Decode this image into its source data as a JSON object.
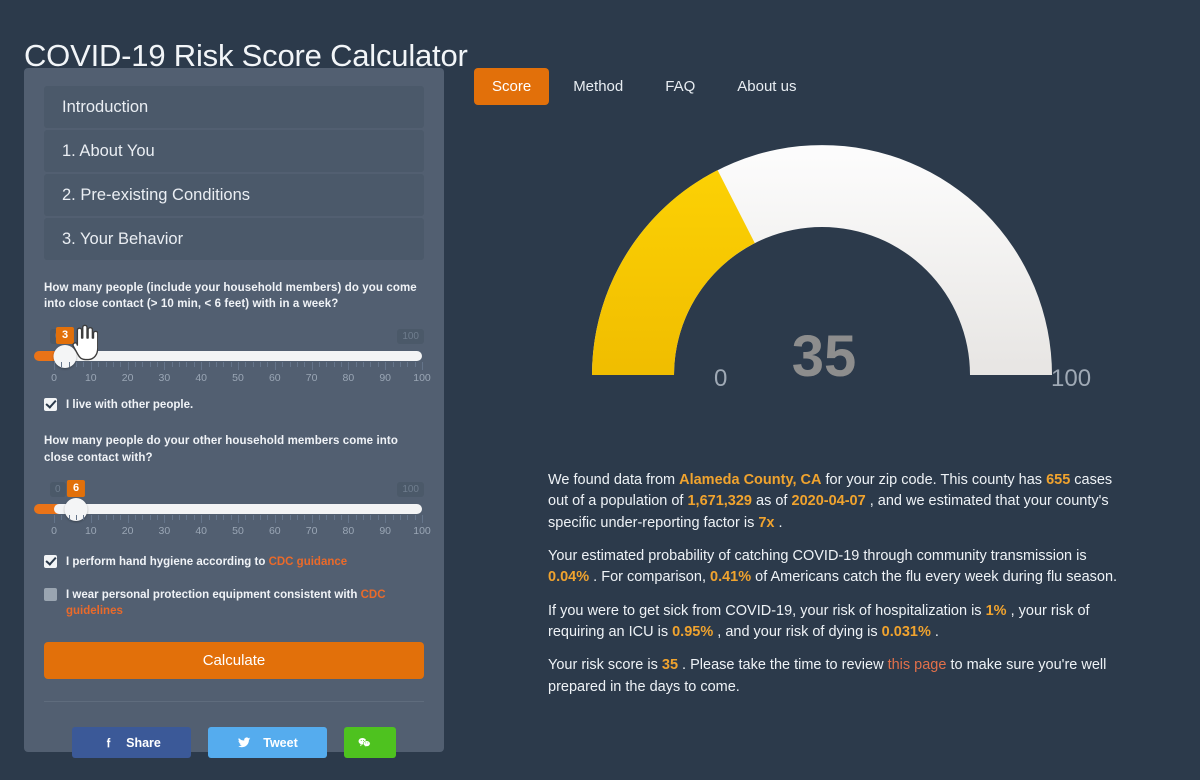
{
  "header": {
    "title": "COVID-19 Risk Score Calculator"
  },
  "colors": {
    "page_bg": "#2c3a4b",
    "panel_bg": "#525f71",
    "nav_item_bg": "#4b596a",
    "accent_orange": "#e2700a",
    "highlight_yellow": "#f0a32e",
    "link_orange": "#ea6a2a",
    "gauge_fill": "#f5c400",
    "gauge_track": "#f0eeec",
    "facebook_blue": "#3b5998",
    "twitter_blue": "#55acee",
    "wechat_green": "#4ec21f"
  },
  "sidebar": {
    "items": [
      {
        "label": "Introduction"
      },
      {
        "label": "1. About You"
      },
      {
        "label": "2. Pre-existing Conditions"
      },
      {
        "label": "3. Your Behavior"
      }
    ]
  },
  "form": {
    "question_1": "How many people (include your household members) do you come into close contact (> 10 min, < 6 feet) with in a week?",
    "slider_1": {
      "value": 3,
      "min": 0,
      "max": 100,
      "min_label": "0",
      "max_label": "100",
      "scale": [
        "0",
        "10",
        "20",
        "30",
        "40",
        "50",
        "60",
        "70",
        "80",
        "90",
        "100"
      ]
    },
    "checkbox_live_with_others": {
      "label": "I live with other people.",
      "checked": true
    },
    "question_2": "How many people do your other household members come into close contact with?",
    "slider_2": {
      "value": 6,
      "min": 0,
      "max": 100,
      "min_label": "0",
      "max_label": "100",
      "scale": [
        "0",
        "10",
        "20",
        "30",
        "40",
        "50",
        "60",
        "70",
        "80",
        "90",
        "100"
      ]
    },
    "checkbox_hand_hygiene": {
      "text_before": "I perform hand hygiene according to ",
      "link_text": "CDC guidance",
      "text_after": "",
      "checked": true
    },
    "checkbox_ppe": {
      "text_before": "I wear personal protection equipment consistent with ",
      "link_text": "CDC guidelines",
      "text_after": "",
      "checked": false
    },
    "calculate_button": "Calculate"
  },
  "share": {
    "facebook_label": "Share",
    "twitter_label": "Tweet",
    "wechat_label": ""
  },
  "tabs": [
    {
      "label": "Score",
      "active": true
    },
    {
      "label": "Method",
      "active": false
    },
    {
      "label": "FAQ",
      "active": false
    },
    {
      "label": "About us",
      "active": false
    }
  ],
  "chart_data": {
    "type": "gauge",
    "title": "",
    "value": 35,
    "min": 0,
    "max": 100,
    "min_label": "0",
    "max_label": "100",
    "value_label": "35",
    "fill_color": "#f5c400",
    "track_color": "#f0eeec",
    "ylabel": "",
    "xlabel": ""
  },
  "results": {
    "p1": {
      "t1": "We found data from ",
      "county": "Alameda County, CA",
      "t2": " for your zip code. This county has ",
      "cases": "655",
      "t3": " cases out of a population of ",
      "population": "1,671,329",
      "t4": " as of ",
      "date": "2020-04-07",
      "t5": " , and we estimated that your county's specific under-reporting factor is ",
      "factor": "7x",
      "t6": " ."
    },
    "p2": {
      "t1": "Your estimated probability of catching COVID-19 through community transmission is ",
      "probability": "0.04%",
      "t2": " . For comparison, ",
      "flu_rate": "0.41%",
      "t3": " of Americans catch the flu every week during flu season."
    },
    "p3": {
      "t1": "If you were to get sick from COVID-19, your risk of hospitalization is ",
      "hospitalization": "1%",
      "t2": " , your risk of requiring an ICU is ",
      "icu": "0.95%",
      "t3": " , and your risk of dying is ",
      "death": "0.031%",
      "t4": " ."
    },
    "p4": {
      "t1": "Your risk score is ",
      "score": "35",
      "t2": " . Please take the time to review ",
      "link": "this page",
      "t3": " to make sure you're well prepared in the days to come."
    }
  }
}
